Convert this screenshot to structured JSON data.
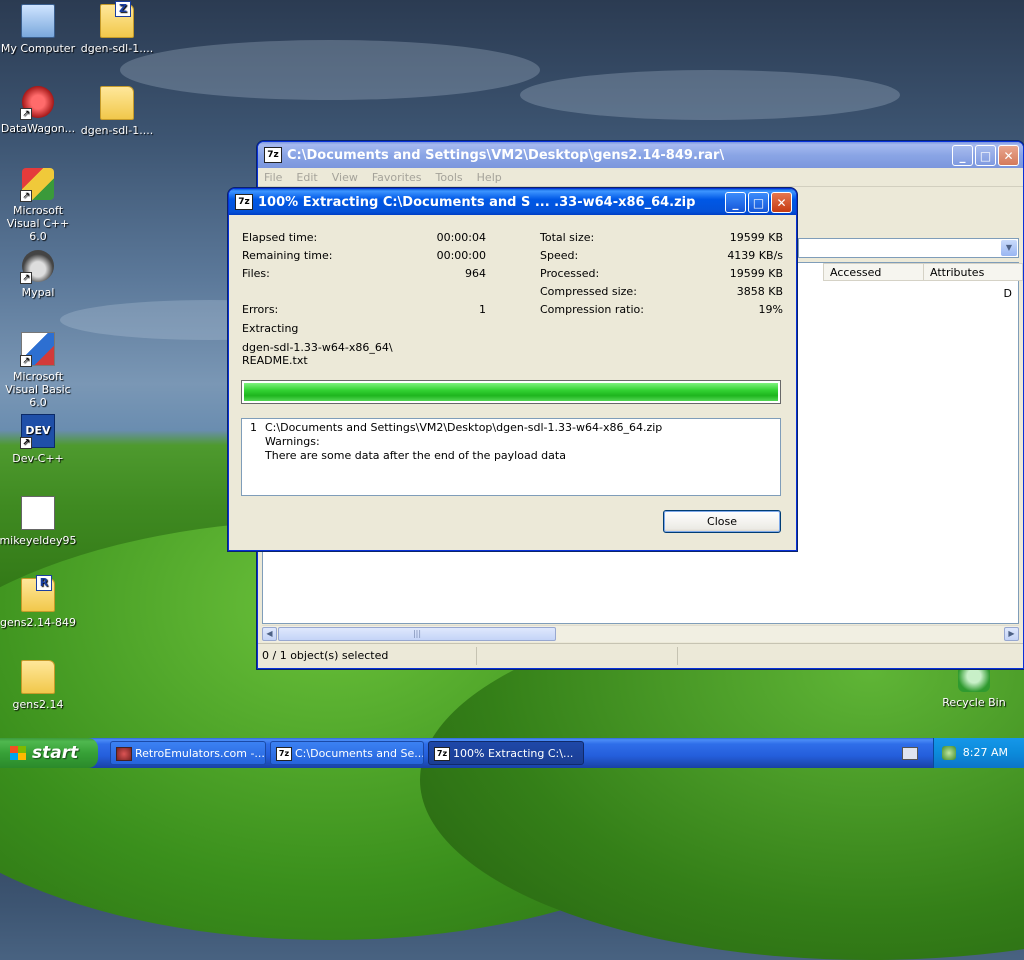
{
  "desktop": {
    "icons": [
      {
        "label": "My Computer",
        "icon": "computer-icon"
      },
      {
        "label": "dgen-sdl-1....",
        "icon": "zip-folder-icon"
      },
      {
        "label": "DataWagon...",
        "icon": "datawagon-icon"
      },
      {
        "label": "dgen-sdl-1....",
        "icon": "folder-icon"
      },
      {
        "label": "Microsoft Visual C++ 6.0",
        "icon": "visual-cpp-icon"
      },
      {
        "label": "Mypal",
        "icon": "mypal-icon"
      },
      {
        "label": "Microsoft Visual Basic 6.0",
        "icon": "visual-basic-icon"
      },
      {
        "label": "Dev-C++",
        "icon": "devcpp-icon",
        "badge": "DEV"
      },
      {
        "label": "mikeyeldey95",
        "icon": "file-icon"
      },
      {
        "label": "gens2.14-849",
        "icon": "rar-folder-icon"
      },
      {
        "label": "gens2.14",
        "icon": "folder-icon"
      },
      {
        "label": "Recycle Bin",
        "icon": "recycle-bin-icon"
      }
    ]
  },
  "main_window": {
    "app_icon": "7z",
    "title": "C:\\Documents and Settings\\VM2\\Desktop\\gens2.14-849.rar\\",
    "menu": [
      "File",
      "Edit",
      "View",
      "Favorites",
      "Tools",
      "Help"
    ],
    "columns": {
      "accessed": "Accessed",
      "attributes": "Attributes"
    },
    "row_attr": "D",
    "status": "0 / 1 object(s) selected"
  },
  "progress_dialog": {
    "app_icon": "7z",
    "title": "100% Extracting C:\\Documents and S ... .33-w64-x86_64.zip",
    "left": {
      "elapsed_label": "Elapsed time:",
      "elapsed_value": "00:00:04",
      "remaining_label": "Remaining time:",
      "remaining_value": "00:00:00",
      "files_label": "Files:",
      "files_value": "964",
      "errors_label": "Errors:",
      "errors_value": "1"
    },
    "right": {
      "total_label": "Total size:",
      "total_value": "19599 KB",
      "speed_label": "Speed:",
      "speed_value": "4139 KB/s",
      "processed_label": "Processed:",
      "processed_value": "19599 KB",
      "compressed_label": "Compressed size:",
      "compressed_value": "3858 KB",
      "ratio_label": "Compression ratio:",
      "ratio_value": "19%"
    },
    "extracting_label": "Extracting",
    "current_path": "dgen-sdl-1.33-w64-x86_64\\",
    "current_file": "README.txt",
    "progress_percent": 100,
    "messages": {
      "index": "1",
      "path": "C:\\Documents and Settings\\VM2\\Desktop\\dgen-sdl-1.33-w64-x86_64.zip",
      "line2": "Warnings:",
      "line3": "There are some data after the end of the payload data"
    },
    "close_label": "Close"
  },
  "taskbar": {
    "start_label": "start",
    "tasks": [
      {
        "label": "RetroEmulators.com -...",
        "icon": "browser-icon"
      },
      {
        "label": "C:\\Documents and Se...",
        "icon": "7z"
      },
      {
        "label": "100% Extracting C:\\...",
        "icon": "7z"
      }
    ],
    "clock": "8:27 AM"
  },
  "colors": {
    "title_active": "#0058e6",
    "progress_green": "#33d233",
    "taskbar_blue": "#245edb",
    "start_green": "#37a137"
  }
}
